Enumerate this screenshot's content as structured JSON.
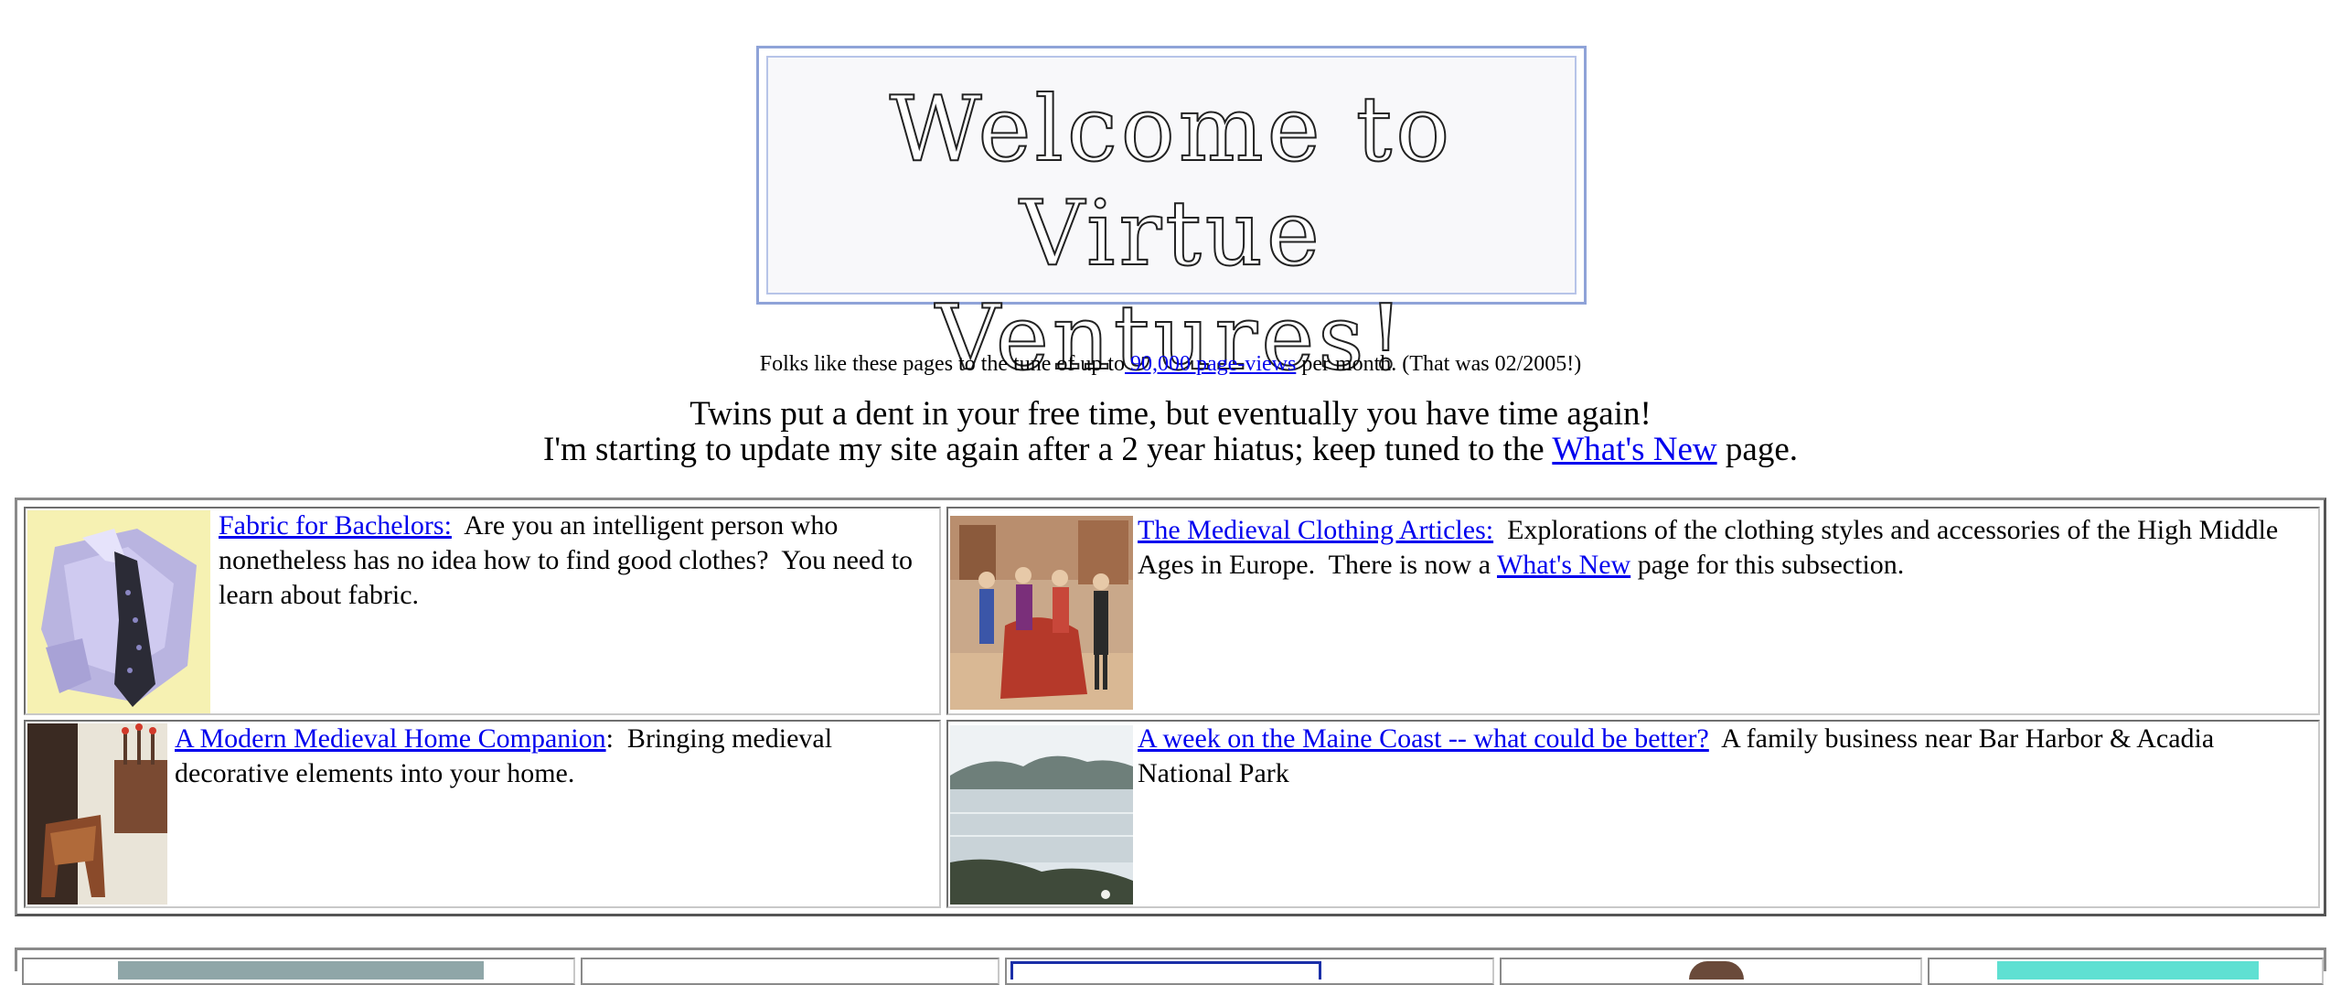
{
  "banner": {
    "line1": "Welcome to",
    "line2": "Virtue Ventures!"
  },
  "stats": {
    "prefix": "Folks like these pages to the tune of up to",
    "link": " 90,000 page-views",
    "suffix": " per month. (That was 02/2005!)"
  },
  "intro": {
    "line1": "Twins put a dent in your free time, but eventually you have time again!",
    "line2_prefix": "I'm starting to update my site again after a 2 year hiatus; keep tuned to the ",
    "line2_link": "What's New",
    "line2_suffix": " page."
  },
  "cells": {
    "fabric": {
      "link": "Fabric for Bachelors:",
      "text": "  Are you an intelligent person who nonetheless has no idea how to find good clothes?  You need to learn about fabric."
    },
    "medieval_clothing": {
      "link": "The Medieval Clothing Articles:",
      "text": "  Explorations of the clothing styles and accessories of the High Middle Ages in Europe.  There is now a ",
      "inner_link": "What's New",
      "text_end": " page for this subsection."
    },
    "home_companion": {
      "link": "A Modern Medieval Home Companion",
      "text": ":  Bringing medieval decorative elements into your home."
    },
    "maine_coast": {
      "link": "A week on the Maine Coast -- what could be better?",
      "text": "  A family business near Bar Harbor & Acadia National Park"
    }
  },
  "colors": {
    "link": "#0000ee",
    "banner_border": "#8fa3d8"
  }
}
